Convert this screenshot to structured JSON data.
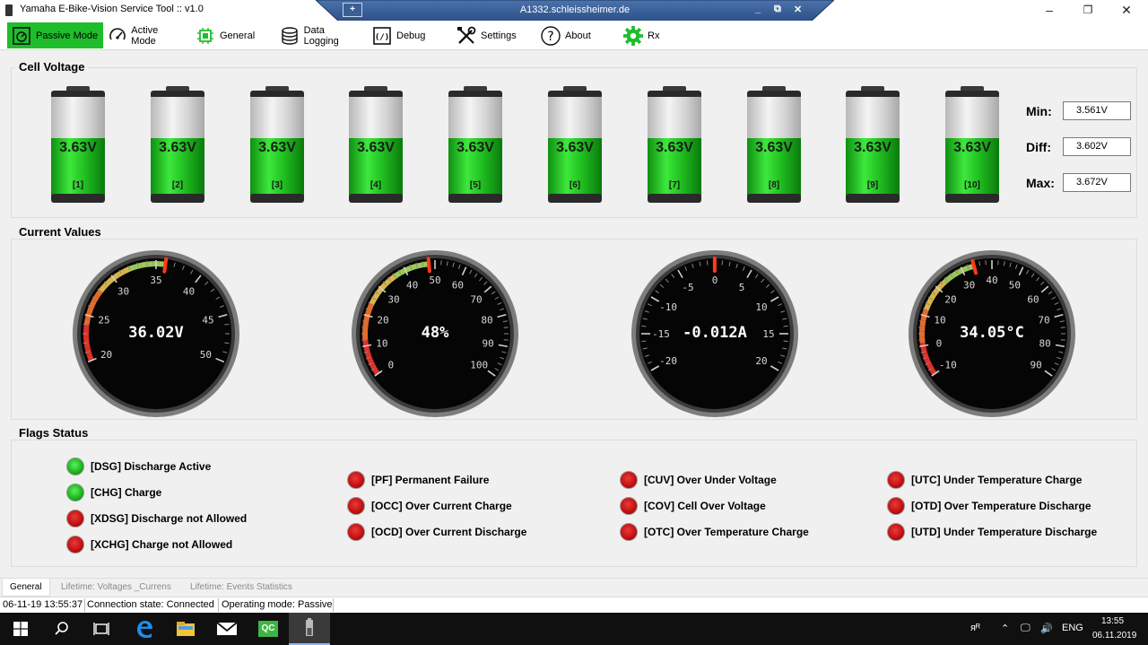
{
  "window": {
    "title": "Yamaha E-Bike-Vision Service Tool :: v1.0",
    "minimize": "–",
    "restore": "❐",
    "close": "✕"
  },
  "remote": {
    "host": "A1332.schleissheimer.de",
    "pin": "+",
    "controls": [
      "_",
      "⧉",
      "✕"
    ]
  },
  "toolbar": {
    "passive_mode": "Passive Mode",
    "active_mode": "Active Mode",
    "general": "General",
    "data_logging": "Data Logging",
    "debug": "Debug",
    "settings": "Settings",
    "about": "About",
    "rx": "Rx",
    "icons": [
      "gauge-icon",
      "speedometer-icon",
      "chip-icon",
      "database-icon",
      "code-icon",
      "tools-icon",
      "help-icon",
      "gear-icon"
    ],
    "active_color": "#1fbd2c"
  },
  "cell_voltage": {
    "title": "Cell Voltage",
    "cells": [
      {
        "voltage": "3.63V",
        "index": "[1]"
      },
      {
        "voltage": "3.63V",
        "index": "[2]"
      },
      {
        "voltage": "3.63V",
        "index": "[3]"
      },
      {
        "voltage": "3.63V",
        "index": "[4]"
      },
      {
        "voltage": "3.63V",
        "index": "[5]"
      },
      {
        "voltage": "3.63V",
        "index": "[6]"
      },
      {
        "voltage": "3.63V",
        "index": "[7]"
      },
      {
        "voltage": "3.63V",
        "index": "[8]"
      },
      {
        "voltage": "3.63V",
        "index": "[9]"
      },
      {
        "voltage": "3.63V",
        "index": "[10]"
      }
    ],
    "min_label": "Min:",
    "min_value": "3.561V",
    "diff_label": "Diff:",
    "diff_value": "3.602V",
    "max_label": "Max:",
    "max_value": "3.672V",
    "fill_color": "#22c322"
  },
  "current_values": {
    "title": "Current Values",
    "gauges": [
      {
        "name": "voltage",
        "value": 36.02,
        "display": "36.02V",
        "min": 15,
        "max": 55,
        "ticks": [
          20,
          25,
          30,
          35,
          40,
          45,
          50
        ],
        "arc_from": 20,
        "arc_to": 36.02
      },
      {
        "name": "percent",
        "value": 48,
        "display": "48%",
        "min": -10,
        "max": 110,
        "ticks": [
          0,
          10,
          20,
          30,
          40,
          50,
          60,
          70,
          80,
          90,
          100
        ],
        "arc_from": 0,
        "arc_to": 48
      },
      {
        "name": "current",
        "value": -0.012,
        "display": "-0.012A",
        "min": -25,
        "max": 25,
        "ticks": [
          -20,
          -15,
          -10,
          -5,
          0,
          5,
          10,
          15,
          20
        ],
        "arc_from": null,
        "arc_to": null
      },
      {
        "name": "temperature",
        "value": 34.05,
        "display": "34.05°C",
        "min": -20,
        "max": 100,
        "ticks": [
          -10,
          0,
          10,
          20,
          30,
          40,
          50,
          60,
          70,
          80,
          90
        ],
        "arc_from": -10,
        "arc_to": 34.05
      }
    ]
  },
  "flags": {
    "title": "Flags Status",
    "items": [
      {
        "label": "[DSG] Discharge Active",
        "state": "green"
      },
      {
        "label": "[CHG] Charge",
        "state": "green"
      },
      {
        "label": "[XDSG] Discharge not Allowed",
        "state": "red"
      },
      {
        "label": "[XCHG] Charge not Allowed",
        "state": "red"
      },
      {
        "label": "[PF] Permanent Failure",
        "state": "red"
      },
      {
        "label": "[OCC] Over Current Charge",
        "state": "red"
      },
      {
        "label": "[OCD] Over Current Discharge",
        "state": "red"
      },
      {
        "label": "[CUV] Over Under Voltage",
        "state": "red"
      },
      {
        "label": "[COV] Cell Over Voltage",
        "state": "red"
      },
      {
        "label": "[OTC] Over Temperature Charge",
        "state": "red"
      },
      {
        "label": "[UTC] Under Temperature Charge",
        "state": "red"
      },
      {
        "label": "[OTD] Over Temperature Discharge",
        "state": "red"
      },
      {
        "label": "[UTD] Under Temperature Discharge",
        "state": "red"
      }
    ]
  },
  "tabs": [
    "General",
    "Lifetime: Voltages _Currens",
    "Lifetime: Events Statistics"
  ],
  "status": {
    "timestamp": "06-11-19  13:55:37",
    "connection": "Connection state: Connected",
    "mode": "Operating mode: Passive"
  },
  "taskbar": {
    "icons": [
      "windows-start-icon",
      "search-icon",
      "task-view-icon",
      "edge-icon",
      "file-explorer-icon",
      "mail-icon",
      "qc-app-icon",
      "service-tool-icon"
    ],
    "qc_label": "QC",
    "tray_people": "ᴙᴿ",
    "tray_arrow": "⌃",
    "tray_network": "🖵",
    "tray_volume": "🔊",
    "language": "ENG",
    "time": "13:55",
    "date": "06.11.2019"
  }
}
